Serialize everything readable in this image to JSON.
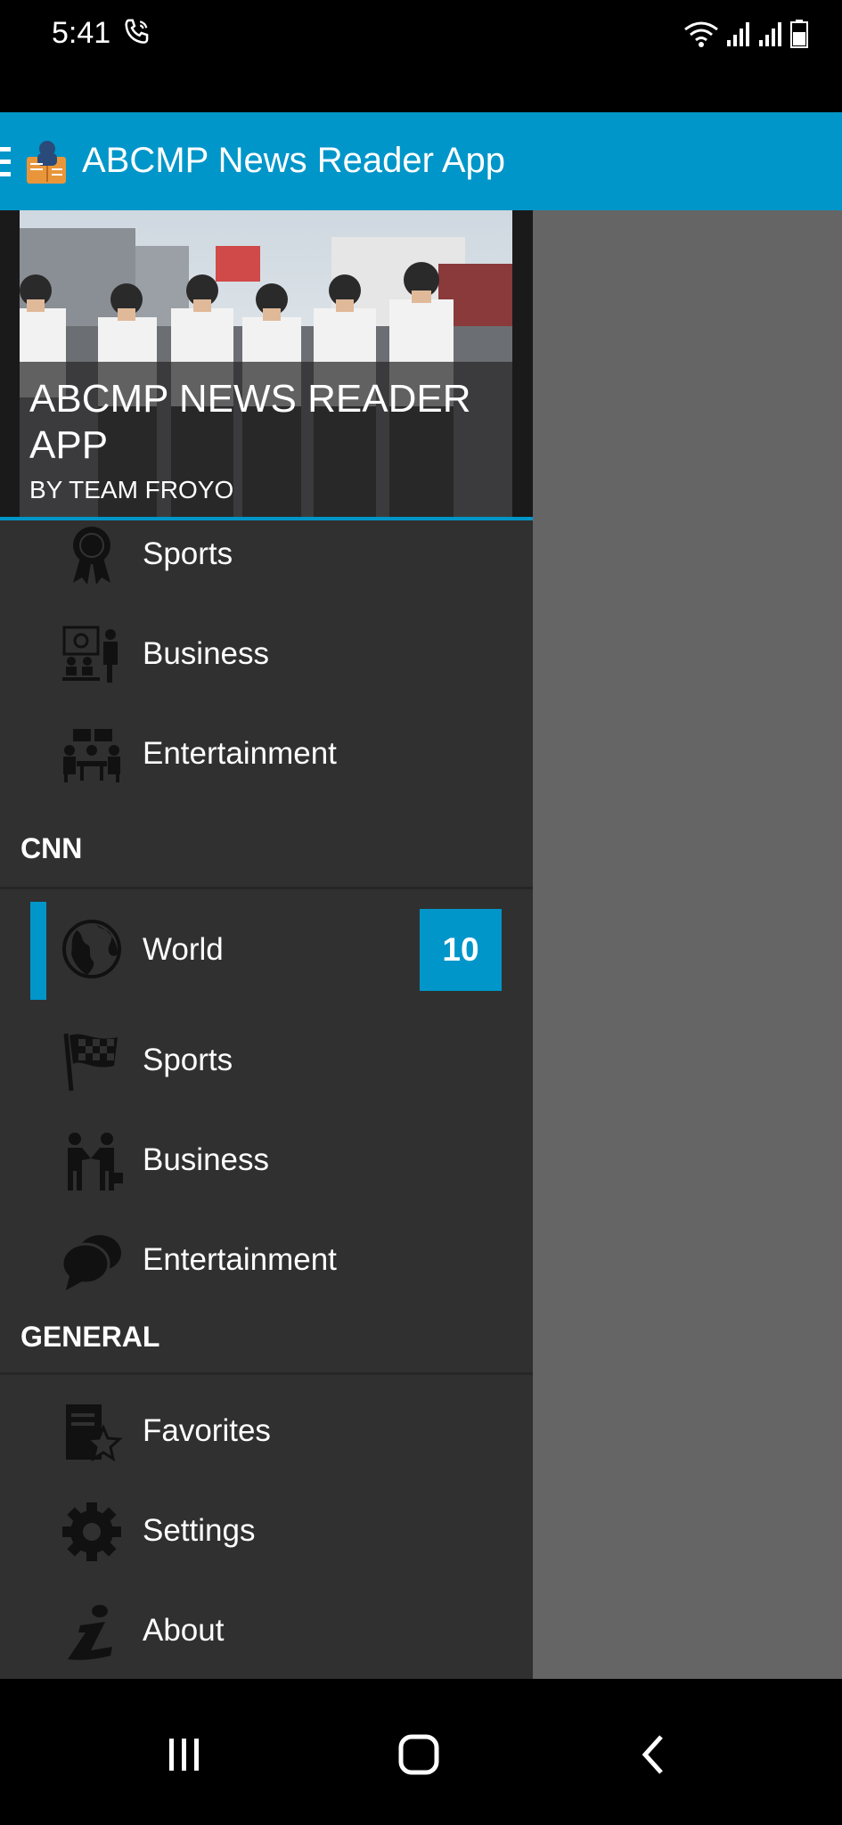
{
  "status_bar": {
    "time": "5:41"
  },
  "app_bar": {
    "title": "ABCMP News Reader App"
  },
  "drawer": {
    "header": {
      "title": "ABCMP NEWS READER APP",
      "subtitle": "BY TEAM FROYO"
    },
    "group1_items": [
      {
        "label": "Sports",
        "icon": "ribbon-award-icon"
      },
      {
        "label": "Business",
        "icon": "presentation-meeting-icon"
      },
      {
        "label": "Entertainment",
        "icon": "group-meeting-icon"
      }
    ],
    "sections": [
      {
        "title": "CNN",
        "items": [
          {
            "label": "World",
            "icon": "globe-icon",
            "badge": "10",
            "active": true
          },
          {
            "label": "Sports",
            "icon": "checkered-flag-icon"
          },
          {
            "label": "Business",
            "icon": "handshake-icon"
          },
          {
            "label": "Entertainment",
            "icon": "speech-bubbles-icon"
          }
        ]
      },
      {
        "title": "GENERAL",
        "items": [
          {
            "label": "Favorites",
            "icon": "favorites-book-star-icon"
          },
          {
            "label": "Settings",
            "icon": "gear-icon"
          },
          {
            "label": "About",
            "icon": "info-icon"
          }
        ]
      }
    ]
  },
  "colors": {
    "accent": "#0096c9",
    "drawer_bg": "#303030",
    "overlay": "#656565"
  }
}
